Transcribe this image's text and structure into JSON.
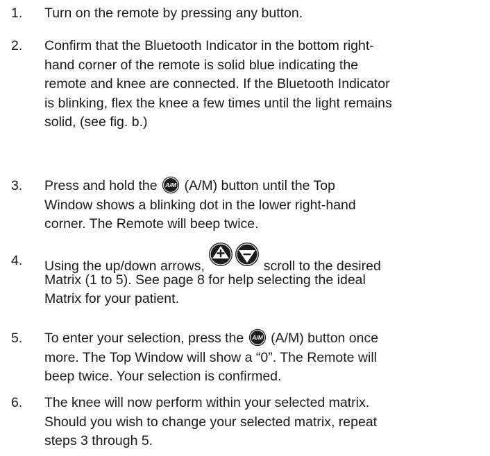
{
  "steps": [
    {
      "num": "1.",
      "lines": [
        "Turn on the remote by pressing any button."
      ]
    },
    {
      "num": "2.",
      "lines": [
        "Confirm that the Bluetooth Indicator in the bottom right-",
        "hand corner of the remote is solid blue indicating the",
        "remote and knee are connected. If the Bluetooth Indicator",
        "is blinking, flex the knee a few times until the light remains",
        "solid, (see fig. b.)"
      ]
    },
    {
      "num": "3.",
      "line1_pre": "Press and hold the",
      "line1_post": "(A/M) button until the Top",
      "lines": [
        "Window shows a blinking dot in the lower right-hand",
        "corner. The Remote will beep twice."
      ]
    },
    {
      "num": "4.",
      "line1_pre": "Using the up/down arrows,",
      "line1_post": "scroll to the desired",
      "lines": [
        "Matrix (1 to 5). See page 8 for help selecting the ideal",
        "Matrix for your patient."
      ]
    },
    {
      "num": "5.",
      "line1_pre": "To enter your selection, press the",
      "line1_post": "(A/M) button once",
      "lines": [
        "more. The Top Window will show a “0”. The Remote will",
        "beep twice. Your selection is confirmed."
      ]
    },
    {
      "num": "6.",
      "lines": [
        "The knee will now perform within your selected matrix.",
        "Should you wish to change your selected matrix, repeat",
        "steps 3 through 5."
      ]
    }
  ],
  "icons": {
    "am_label": "A/M",
    "am_icon": "am-button-icon",
    "up_icon": "up-arrow-button-icon",
    "down_icon": "down-arrow-button-icon"
  }
}
